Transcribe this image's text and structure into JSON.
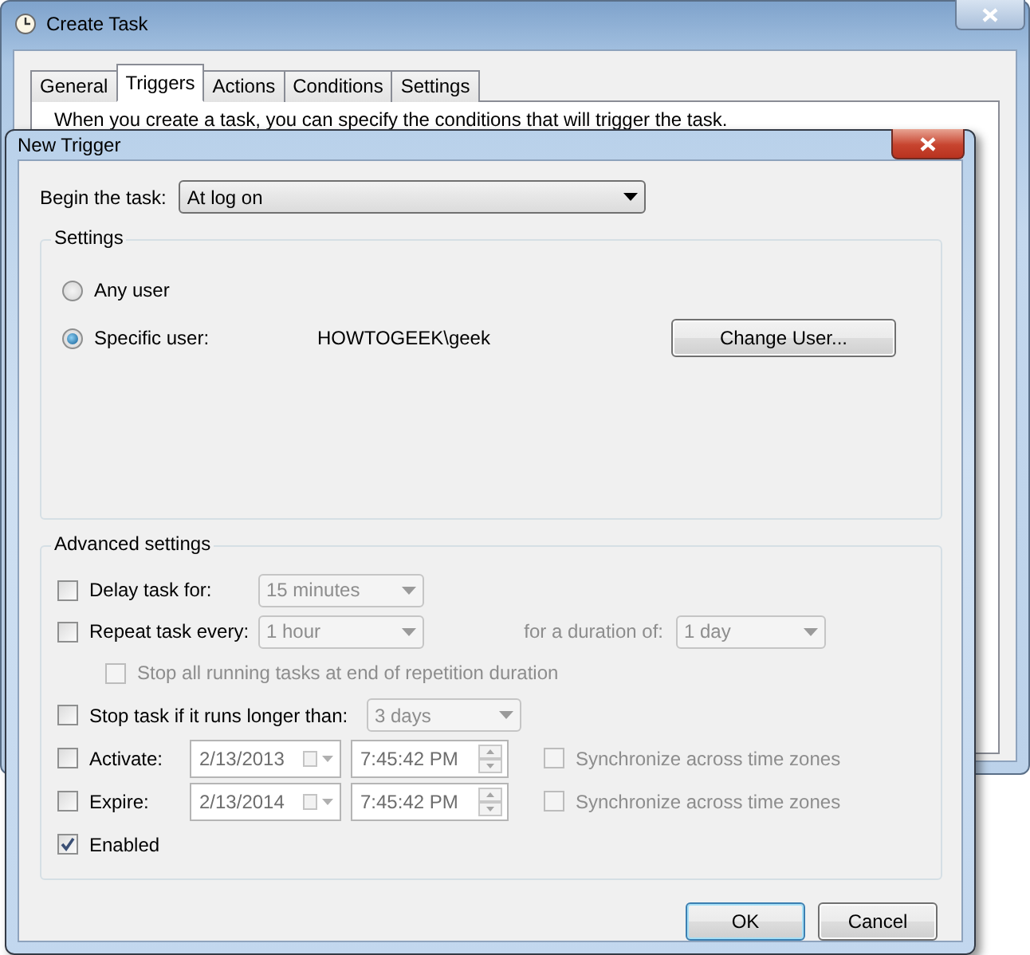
{
  "create_task_window": {
    "title": "Create Task",
    "tabs": [
      {
        "label": "General",
        "selected": false
      },
      {
        "label": "Triggers",
        "selected": true
      },
      {
        "label": "Actions",
        "selected": false
      },
      {
        "label": "Conditions",
        "selected": false
      },
      {
        "label": "Settings",
        "selected": false
      }
    ],
    "description": "When you create a task, you can specify the conditions that will trigger the task."
  },
  "new_trigger_dialog": {
    "title": "New Trigger",
    "begin_the_task": {
      "label": "Begin the task:",
      "value": "At log on"
    },
    "settings": {
      "title": "Settings",
      "options": [
        {
          "label": "Any user",
          "selected": false
        },
        {
          "label": "Specific user:",
          "selected": true,
          "value": "HOWTOGEEK\\geek"
        }
      ],
      "change_user_button": "Change User..."
    },
    "advanced_settings": {
      "title": "Advanced settings",
      "delay": {
        "label": "Delay task for:",
        "checked": false,
        "value": "15 minutes",
        "disabled": true
      },
      "repeat": {
        "label": "Repeat task every:",
        "checked": false,
        "value": "1 hour",
        "disabled": true,
        "duration_label": "for a duration of:",
        "duration_value": "1 day"
      },
      "stop_all": {
        "label": "Stop all running tasks at end of repetition duration",
        "checked": false,
        "disabled": true
      },
      "stop_longer": {
        "label": "Stop task if it runs longer than:",
        "checked": false,
        "value": "3 days",
        "disabled": true
      },
      "activate": {
        "label": "Activate:",
        "checked": false,
        "date": "2/13/2013",
        "time": "7:45:42 PM",
        "sync_label": "Synchronize across time zones",
        "sync_checked": false,
        "sync_disabled": true
      },
      "expire": {
        "label": "Expire:",
        "checked": false,
        "date": "2/13/2014",
        "time": "7:45:42 PM",
        "sync_label": "Synchronize across time zones",
        "sync_checked": false,
        "sync_disabled": true
      },
      "enabled": {
        "label": "Enabled",
        "checked": true
      }
    },
    "buttons": [
      {
        "label": "OK",
        "default": true
      },
      {
        "label": "Cancel",
        "default": false
      }
    ]
  }
}
